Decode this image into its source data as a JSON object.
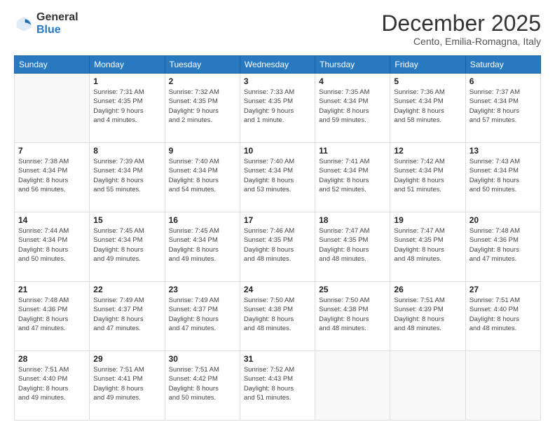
{
  "logo": {
    "general": "General",
    "blue": "Blue"
  },
  "title": "December 2025",
  "subtitle": "Cento, Emilia-Romagna, Italy",
  "days": [
    "Sunday",
    "Monday",
    "Tuesday",
    "Wednesday",
    "Thursday",
    "Friday",
    "Saturday"
  ],
  "weeks": [
    [
      {
        "date": "",
        "info": ""
      },
      {
        "date": "1",
        "info": "Sunrise: 7:31 AM\nSunset: 4:35 PM\nDaylight: 9 hours\nand 4 minutes."
      },
      {
        "date": "2",
        "info": "Sunrise: 7:32 AM\nSunset: 4:35 PM\nDaylight: 9 hours\nand 2 minutes."
      },
      {
        "date": "3",
        "info": "Sunrise: 7:33 AM\nSunset: 4:35 PM\nDaylight: 9 hours\nand 1 minute."
      },
      {
        "date": "4",
        "info": "Sunrise: 7:35 AM\nSunset: 4:34 PM\nDaylight: 8 hours\nand 59 minutes."
      },
      {
        "date": "5",
        "info": "Sunrise: 7:36 AM\nSunset: 4:34 PM\nDaylight: 8 hours\nand 58 minutes."
      },
      {
        "date": "6",
        "info": "Sunrise: 7:37 AM\nSunset: 4:34 PM\nDaylight: 8 hours\nand 57 minutes."
      }
    ],
    [
      {
        "date": "7",
        "info": "Sunrise: 7:38 AM\nSunset: 4:34 PM\nDaylight: 8 hours\nand 56 minutes."
      },
      {
        "date": "8",
        "info": "Sunrise: 7:39 AM\nSunset: 4:34 PM\nDaylight: 8 hours\nand 55 minutes."
      },
      {
        "date": "9",
        "info": "Sunrise: 7:40 AM\nSunset: 4:34 PM\nDaylight: 8 hours\nand 54 minutes."
      },
      {
        "date": "10",
        "info": "Sunrise: 7:40 AM\nSunset: 4:34 PM\nDaylight: 8 hours\nand 53 minutes."
      },
      {
        "date": "11",
        "info": "Sunrise: 7:41 AM\nSunset: 4:34 PM\nDaylight: 8 hours\nand 52 minutes."
      },
      {
        "date": "12",
        "info": "Sunrise: 7:42 AM\nSunset: 4:34 PM\nDaylight: 8 hours\nand 51 minutes."
      },
      {
        "date": "13",
        "info": "Sunrise: 7:43 AM\nSunset: 4:34 PM\nDaylight: 8 hours\nand 50 minutes."
      }
    ],
    [
      {
        "date": "14",
        "info": "Sunrise: 7:44 AM\nSunset: 4:34 PM\nDaylight: 8 hours\nand 50 minutes."
      },
      {
        "date": "15",
        "info": "Sunrise: 7:45 AM\nSunset: 4:34 PM\nDaylight: 8 hours\nand 49 minutes."
      },
      {
        "date": "16",
        "info": "Sunrise: 7:45 AM\nSunset: 4:34 PM\nDaylight: 8 hours\nand 49 minutes."
      },
      {
        "date": "17",
        "info": "Sunrise: 7:46 AM\nSunset: 4:35 PM\nDaylight: 8 hours\nand 48 minutes."
      },
      {
        "date": "18",
        "info": "Sunrise: 7:47 AM\nSunset: 4:35 PM\nDaylight: 8 hours\nand 48 minutes."
      },
      {
        "date": "19",
        "info": "Sunrise: 7:47 AM\nSunset: 4:35 PM\nDaylight: 8 hours\nand 48 minutes."
      },
      {
        "date": "20",
        "info": "Sunrise: 7:48 AM\nSunset: 4:36 PM\nDaylight: 8 hours\nand 47 minutes."
      }
    ],
    [
      {
        "date": "21",
        "info": "Sunrise: 7:48 AM\nSunset: 4:36 PM\nDaylight: 8 hours\nand 47 minutes."
      },
      {
        "date": "22",
        "info": "Sunrise: 7:49 AM\nSunset: 4:37 PM\nDaylight: 8 hours\nand 47 minutes."
      },
      {
        "date": "23",
        "info": "Sunrise: 7:49 AM\nSunset: 4:37 PM\nDaylight: 8 hours\nand 47 minutes."
      },
      {
        "date": "24",
        "info": "Sunrise: 7:50 AM\nSunset: 4:38 PM\nDaylight: 8 hours\nand 48 minutes."
      },
      {
        "date": "25",
        "info": "Sunrise: 7:50 AM\nSunset: 4:38 PM\nDaylight: 8 hours\nand 48 minutes."
      },
      {
        "date": "26",
        "info": "Sunrise: 7:51 AM\nSunset: 4:39 PM\nDaylight: 8 hours\nand 48 minutes."
      },
      {
        "date": "27",
        "info": "Sunrise: 7:51 AM\nSunset: 4:40 PM\nDaylight: 8 hours\nand 48 minutes."
      }
    ],
    [
      {
        "date": "28",
        "info": "Sunrise: 7:51 AM\nSunset: 4:40 PM\nDaylight: 8 hours\nand 49 minutes."
      },
      {
        "date": "29",
        "info": "Sunrise: 7:51 AM\nSunset: 4:41 PM\nDaylight: 8 hours\nand 49 minutes."
      },
      {
        "date": "30",
        "info": "Sunrise: 7:51 AM\nSunset: 4:42 PM\nDaylight: 8 hours\nand 50 minutes."
      },
      {
        "date": "31",
        "info": "Sunrise: 7:52 AM\nSunset: 4:43 PM\nDaylight: 8 hours\nand 51 minutes."
      },
      {
        "date": "",
        "info": ""
      },
      {
        "date": "",
        "info": ""
      },
      {
        "date": "",
        "info": ""
      }
    ]
  ]
}
